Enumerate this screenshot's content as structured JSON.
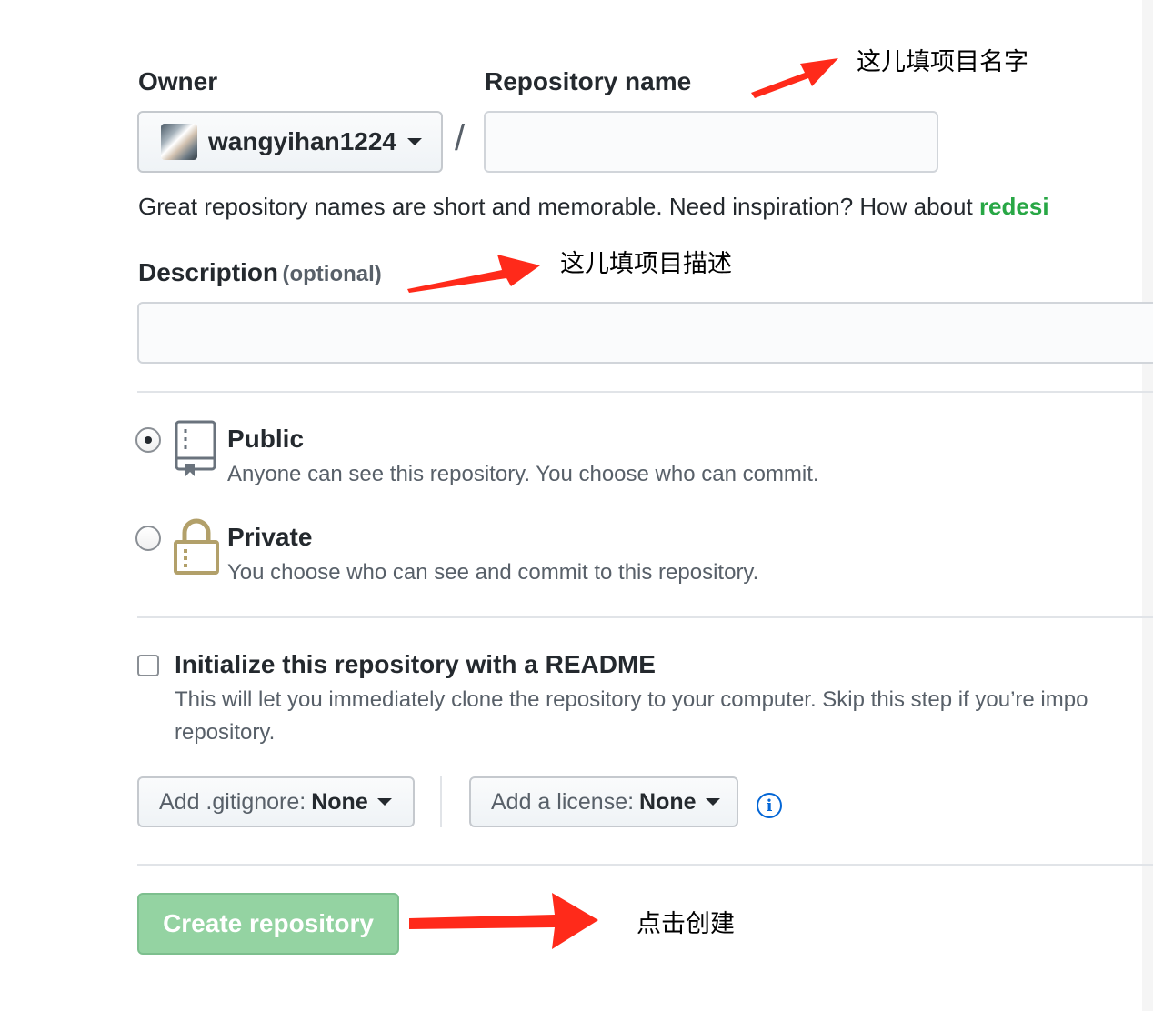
{
  "owner": {
    "label": "Owner",
    "selected": "wangyihan1224"
  },
  "repo_name": {
    "label": "Repository name",
    "value": "",
    "separator": "/"
  },
  "hint": {
    "text": "Great repository names are short and memorable. Need inspiration? How about",
    "suggestion": "redesi"
  },
  "description": {
    "label": "Description",
    "optional": "(optional)",
    "value": ""
  },
  "visibility": {
    "public": {
      "title": "Public",
      "desc": "Anyone can see this repository. You choose who can commit.",
      "checked": true
    },
    "private": {
      "title": "Private",
      "desc": "You choose who can see and commit to this repository.",
      "checked": false
    }
  },
  "readme": {
    "title": "Initialize this repository with a README",
    "desc_line1": "This will let you immediately clone the repository to your computer. Skip this step if you’re impo",
    "desc_line2": "repository.",
    "checked": false
  },
  "gitignore": {
    "prefix": "Add .gitignore:",
    "value": "None"
  },
  "license": {
    "prefix": "Add a license:",
    "value": "None"
  },
  "info_icon": "info-icon",
  "create_button": {
    "label": "Create repository"
  },
  "annotations": {
    "name": "这儿填项目名字",
    "description": "这儿填项目描述",
    "create": "点击创建"
  },
  "colors": {
    "suggestion": "#28a745",
    "create_button": "#94d3a2",
    "arrow": "#ff2a1a",
    "info": "#0366d6"
  }
}
